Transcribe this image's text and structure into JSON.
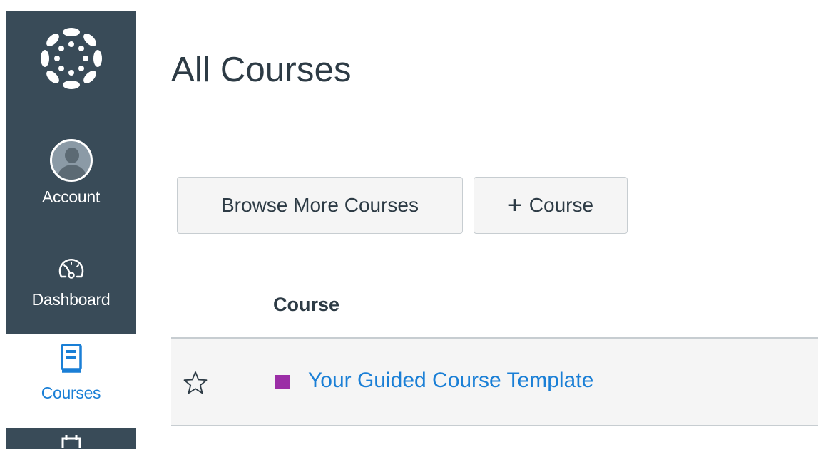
{
  "nav": {
    "account_label": "Account",
    "dashboard_label": "Dashboard",
    "courses_label": "Courses",
    "colors": {
      "background": "#394b58",
      "active": "#1a7fd6"
    }
  },
  "main": {
    "title": "All Courses",
    "buttons": {
      "browse_label": "Browse More Courses",
      "add_course_label": "Course"
    },
    "table": {
      "column_header": "Course",
      "rows": [
        {
          "name": "Your Guided Course Template",
          "color": "#9b2ea6",
          "favorited": false
        }
      ]
    }
  }
}
